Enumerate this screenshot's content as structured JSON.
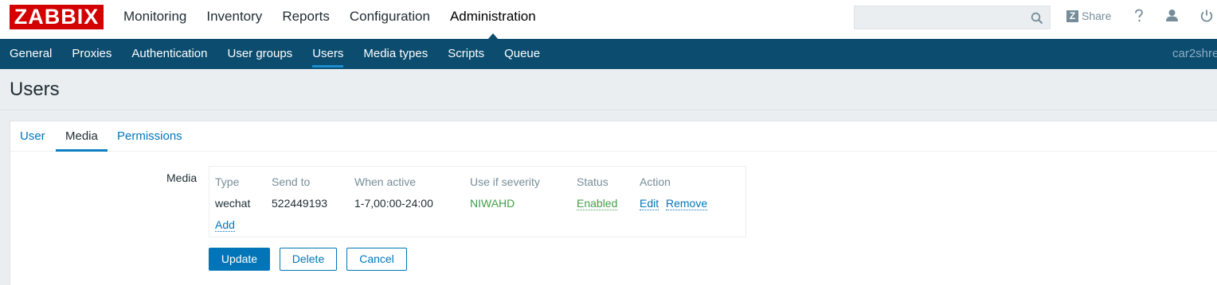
{
  "brand": {
    "logo_text": "ZABBIX",
    "accent": "#d40000",
    "nav_bg": "#0b4c6f",
    "link": "#0275b8",
    "ok": "#429e47"
  },
  "top_nav": {
    "items": [
      "Monitoring",
      "Inventory",
      "Reports",
      "Configuration",
      "Administration"
    ],
    "active": "Administration"
  },
  "header": {
    "search_value": "",
    "share_label": "Share",
    "help_icon": "question-icon",
    "profile_icon": "user-icon",
    "logout_icon": "power-icon"
  },
  "sub_nav": {
    "items": [
      "General",
      "Proxies",
      "Authentication",
      "User groups",
      "Users",
      "Media types",
      "Scripts",
      "Queue"
    ],
    "active": "Users",
    "server_name": "car2shre"
  },
  "page": {
    "title": "Users"
  },
  "tabs": {
    "items": [
      "User",
      "Media",
      "Permissions"
    ],
    "active": "Media"
  },
  "media": {
    "label": "Media",
    "headers": [
      "Type",
      "Send to",
      "When active",
      "Use if severity",
      "Status",
      "Action"
    ],
    "rows": [
      {
        "type": "wechat",
        "send_to": "522449193",
        "when_active": "1-7,00:00-24:00",
        "severity": "NIWAHD",
        "status": "Enabled",
        "edit": "Edit",
        "remove": "Remove"
      }
    ],
    "add_label": "Add"
  },
  "buttons": {
    "update": "Update",
    "delete": "Delete",
    "cancel": "Cancel"
  }
}
